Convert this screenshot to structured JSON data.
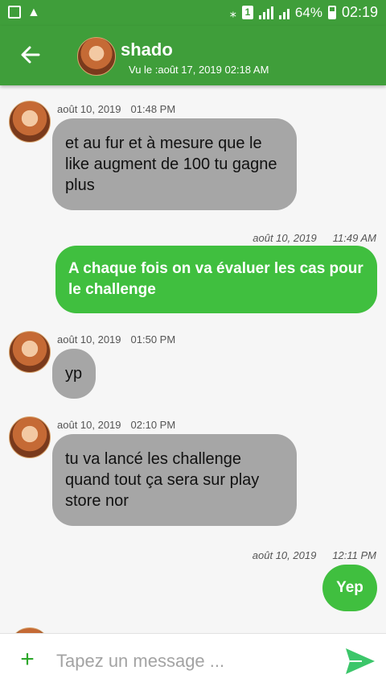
{
  "status_bar": {
    "battery": "64%",
    "time": "02:19",
    "sim": "1"
  },
  "header": {
    "name": "shado",
    "last_seen": "Vu le :août 17, 2019 02:18 AM"
  },
  "messages": [
    {
      "dir": "in",
      "date": "août 10, 2019",
      "time": "01:48 PM",
      "text": "et au fur et à mesure que le like augment de 100 tu gagne plus"
    },
    {
      "dir": "out",
      "date": "août 10, 2019",
      "time": "11:49 AM",
      "text": "A chaque fois on va évaluer les cas pour le challenge"
    },
    {
      "dir": "in",
      "date": "août 10, 2019",
      "time": "01:50 PM",
      "text": "yp"
    },
    {
      "dir": "in",
      "date": "août 10, 2019",
      "time": "02:10 PM",
      "text": "tu va lancé les challenge quand tout ça sera sur play store nor"
    },
    {
      "dir": "out",
      "date": "août 10, 2019",
      "time": "12:11 PM",
      "text": "Yep"
    }
  ],
  "composer": {
    "placeholder": "Tapez un message ..."
  },
  "colors": {
    "header": "#3f9e3a",
    "incoming_bubble": "#a6a6a6",
    "outgoing_bubble": "#40bf3f",
    "send": "#3cc66a"
  }
}
